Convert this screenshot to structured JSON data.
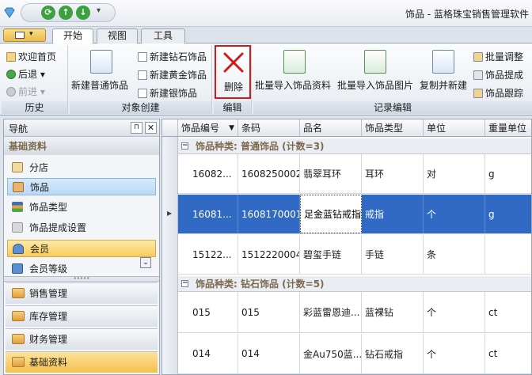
{
  "window": {
    "title": "饰品 - 蓝格珠宝销售管理软件"
  },
  "tabs": [
    "开始",
    "视图",
    "工具"
  ],
  "ribbon": {
    "history": {
      "label": "历史",
      "welcome": "欢迎首页",
      "back": "后退",
      "forward": "前进"
    },
    "create": {
      "label": "对象创建",
      "new_normal": "新建普通饰品",
      "new_diamond": "新建钻石饰品",
      "new_gold": "新建黄金饰品",
      "new_silver": "新建银饰品"
    },
    "edit": {
      "label": "编辑",
      "delete": "删除"
    },
    "records": {
      "label": "记录编辑",
      "import_data": "批量导入饰品资料",
      "import_image": "批量导入饰品图片",
      "copy_new": "复制并新建",
      "batch_adjust": "批量调整",
      "commission": "饰品提成",
      "trace": "饰品跟踪"
    }
  },
  "nav": {
    "title": "导航",
    "section": "基础资料",
    "items": [
      "分店",
      "饰品",
      "饰品类型",
      "饰品提成设置",
      "会员",
      "会员等级"
    ],
    "categories": [
      "销售管理",
      "库存管理",
      "财务管理",
      "基础资料"
    ]
  },
  "grid": {
    "columns": [
      "饰品编号",
      "条码",
      "品名",
      "饰品类型",
      "单位",
      "重量单位"
    ],
    "groups": [
      {
        "label": "饰品种类: 普通饰品 (计数=3)",
        "rows": [
          [
            "16082...",
            "1608250002",
            "翡翠耳环",
            "耳环",
            "对",
            "g"
          ],
          [
            "16081...",
            "1608170001",
            "足金蓝钻戒指",
            "戒指",
            "个",
            "g"
          ],
          [
            "15122...",
            "1512220004",
            "碧玺手链",
            "手链",
            "条",
            ""
          ]
        ]
      },
      {
        "label": "饰品种类: 钻石饰品 (计数=5)",
        "rows": [
          [
            "015",
            "015",
            "彩蓝雷恩迪...",
            "蓝裸钻",
            "个",
            "ct"
          ],
          [
            "014",
            "014",
            "金Au750蓝...",
            "钻石戒指",
            "个",
            "ct"
          ]
        ]
      }
    ]
  },
  "colors": {
    "selection": "#316ac5",
    "accent_gold": "#f4c04d",
    "delete_red": "#d11a1a"
  }
}
